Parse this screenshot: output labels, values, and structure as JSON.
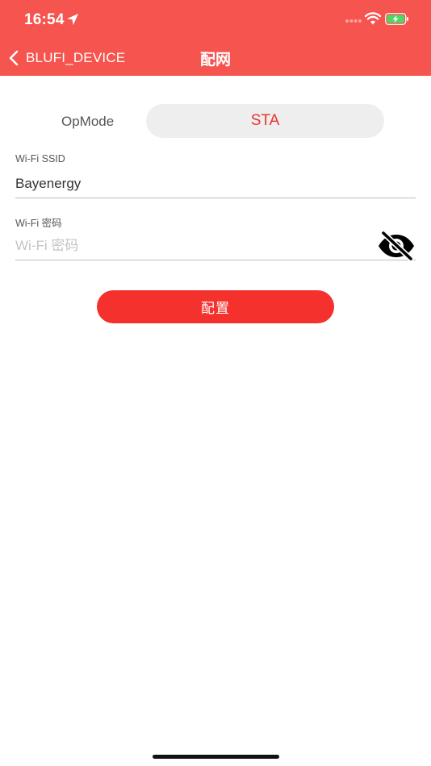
{
  "status_bar": {
    "time": "16:54"
  },
  "nav": {
    "back_label": "BLUFI_DEVICE",
    "title": "配网"
  },
  "form": {
    "opmode_label": "OpMode",
    "opmode_value": "STA",
    "ssid_label": "Wi-Fi SSID",
    "ssid_value": "Bayenergy",
    "password_label": "Wi-Fi 密码",
    "password_placeholder": "Wi-Fi 密码",
    "password_value": ""
  },
  "actions": {
    "submit_label": "配置"
  },
  "colors": {
    "header_bg": "#f6544f",
    "accent": "#e8352d",
    "button_bg": "#f4312d",
    "battery_green": "#4cd964"
  }
}
